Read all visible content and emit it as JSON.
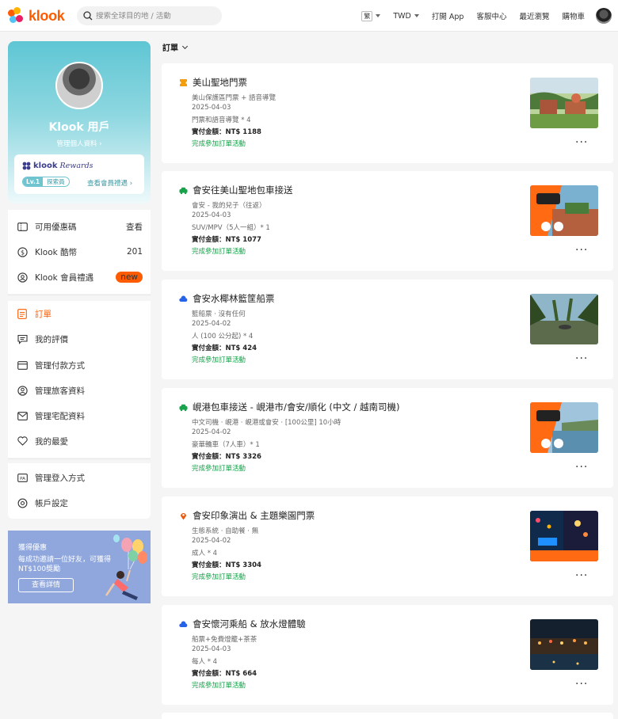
{
  "header": {
    "logo_text": "klook",
    "search_placeholder": "搜索全球目的地 / 活動",
    "lang": "繁",
    "currency": "TWD",
    "app": "打開 App",
    "help": "客服中心",
    "recent": "最近瀏覽",
    "cart": "購物車"
  },
  "profile": {
    "name": "Klook 用戶",
    "manage_link": "管理個人資料 ›",
    "rewards_brand": "klook",
    "rewards_script": "Rewards",
    "level": "Lv.1",
    "level_name": "探索員",
    "rewards_link": "查看會員禮遇 ›"
  },
  "menu1": [
    {
      "label": "可用優惠碼",
      "right": "查看",
      "icon": "coupon-icon"
    },
    {
      "label": "Klook 酷幣",
      "right": "201",
      "icon": "coin-icon"
    },
    {
      "label": "Klook 會員禮遇",
      "badge": "new",
      "icon": "member-icon"
    }
  ],
  "menu2": [
    {
      "label": "訂單",
      "icon": "order-icon",
      "active": true
    },
    {
      "label": "我的評價",
      "icon": "review-icon"
    },
    {
      "label": "管理付款方式",
      "icon": "card-icon"
    },
    {
      "label": "管理旅客資料",
      "icon": "traveler-icon"
    },
    {
      "label": "管理宅配資料",
      "icon": "mail-icon"
    },
    {
      "label": "我的最愛",
      "icon": "heart-icon"
    }
  ],
  "menu3": [
    {
      "label": "管理登入方式",
      "icon": "login-icon"
    },
    {
      "label": "帳戶設定",
      "icon": "settings-icon"
    }
  ],
  "promo": {
    "title": "獲得優惠",
    "text": "每成功邀請一位好友，可獲得NT$100獎勵",
    "button": "查看詳情"
  },
  "filter": {
    "label": "訂單"
  },
  "orders": [
    {
      "title": "美山聖地門票",
      "icon": "ticket-icon",
      "icon_color": "#f59e0b",
      "line1": "美山保護區門票 + 語音導覽",
      "date": "2025-04-03",
      "line3": "門票和語音導覽 * 4",
      "price": "實付金額：NT$ 1188",
      "status": "完成參加訂單活動",
      "thumb": "temple"
    },
    {
      "title": "會安往美山聖地包車接送",
      "icon": "car-icon",
      "icon_color": "#16a34a",
      "line1": "會安 - 我的兒子（往返）",
      "date": "2025-04-03",
      "line3": "SUV/MPV（5人一組）* 1",
      "price": "實付金額：NT$ 1077",
      "status": "完成參加訂單活動",
      "thumb": "car-temple"
    },
    {
      "title": "會安水椰林籃筐船票",
      "icon": "cloud-icon",
      "icon_color": "#2563eb",
      "line1": "籃船票 · 沒有任何",
      "date": "2025-04-02",
      "line3": "人 (100 公分起) * 4",
      "price": "實付金額：NT$ 424",
      "status": "完成參加訂單活動",
      "thumb": "palm"
    },
    {
      "title": "峴港包車接送 - 峴港市/會安/順化 (中文 / 越南司機)",
      "icon": "car-icon",
      "icon_color": "#16a34a",
      "line1": "中文司機 · 峴港 · 峴港或會安 · [100公里] 10小時",
      "date": "2025-04-02",
      "line3": "豪華轎車（7人車）* 1",
      "price": "實付金額：NT$ 3326",
      "status": "完成參加訂單活動",
      "thumb": "car-harbor"
    },
    {
      "title": "會安印象演出 & 主題樂園門票",
      "icon": "pin-icon",
      "icon_color": "#ea580c",
      "line1": "生態系統 · 自助餐 · 無",
      "date": "2025-04-02",
      "line3": "成人 * 4",
      "price": "實付金額：NT$ 3304",
      "status": "完成參加訂單活動",
      "thumb": "show"
    },
    {
      "title": "會安懷河乘船 & 放水燈體驗",
      "icon": "cloud-icon",
      "icon_color": "#2563eb",
      "line1": "船票+免費燈籠+茶茶",
      "date": "2025-04-03",
      "line3": "每人 * 4",
      "price": "實付金額：NT$ 664",
      "status": "完成參加訂單活動",
      "thumb": "lantern"
    }
  ],
  "more_label": "···"
}
